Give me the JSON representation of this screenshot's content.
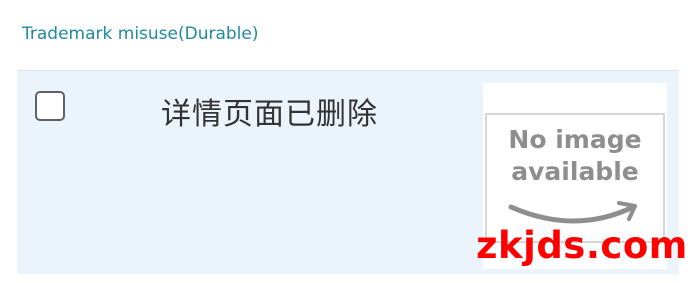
{
  "section": {
    "title": "Trademark misuse(Durable)"
  },
  "row": {
    "checkbox_checked": false,
    "product_title": "详情页面已删除",
    "thumbnail": {
      "placeholder_line1": "No image",
      "placeholder_line2": "available"
    }
  },
  "watermark": {
    "text": "zkjds.com"
  },
  "colors": {
    "title": "#1f8a9e",
    "row_background": "#ebf3fb",
    "watermark": "#ff0000"
  }
}
